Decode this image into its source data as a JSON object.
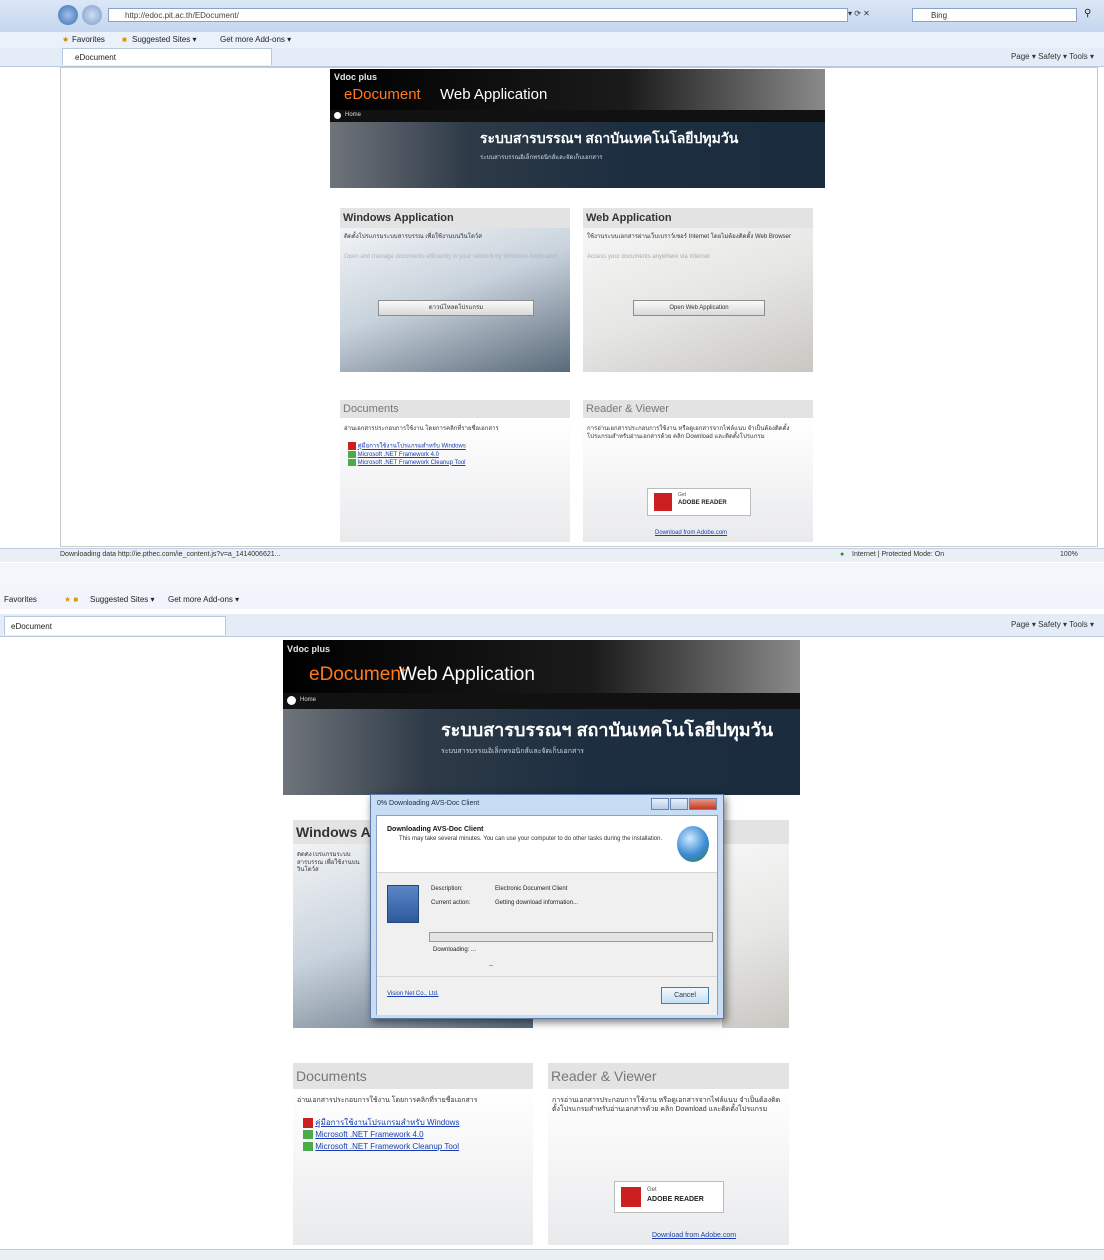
{
  "browser": {
    "url_top": "http://edoc.pit.ac.th/EDocument/",
    "search_engine": "Bing",
    "favorites_label": "Favorites",
    "suggested_sites": "Suggested Sites ▾",
    "get_addons": "Get more Add-ons ▾",
    "tab_title": "eDocument",
    "commands": "Page ▾  Safety ▾  Tools ▾",
    "status_text": "Downloading data http://ie.pthec.com/ie_content.js?v=a_1414006621...",
    "zone_text": "Internet | Protected Mode: On",
    "zoom": "100%"
  },
  "site": {
    "logo_small": "Vdoc plus",
    "logo_e": "eDocument",
    "logo_app": "Web Application",
    "home_label": "Home",
    "banner_title": "ระบบสารบรรณฯ สถาบันเทคโนโลยีปทุมวัน",
    "banner_sub": "ระบบสารบรรณอิเล็กทรอนิกส์และจัดเก็บเอกสาร",
    "windows_title": "Windows Application",
    "windows_title_partial": "Windows Ap",
    "windows_text": "ติดตั้งโปรแกรมระบบสารบรรณ เพื่อใช้งานบนวินโดว์ส",
    "windows_text2": "Open and manage documents efficiently in your network by Windows Application",
    "windows_button": "ดาวน์โหลดโปรแกรม",
    "web_title": "Web Application",
    "web_text": "ใช้งานระบบเอกสารผ่านเว็บเบราว์เซอร์ Internet โดยไม่ต้องติดตั้ง Web Browser",
    "web_text2": "Access your documents anywhere via Internet",
    "web_button": "Open Web Application",
    "documents_title": "Documents",
    "documents_text": "อ่านเอกสารประกอบการใช้งาน โดยการคลิกที่รายชื่อเอกสาร",
    "doc_links": [
      "คู่มือการใช้งานโปรแกรมสำหรับ Windows",
      "Microsoft .NET Framework 4.0",
      "Microsoft .NET Framework Cleanup Tool"
    ],
    "reader_title": "Reader & Viewer",
    "reader_text": "การอ่านเอกสารประกอบการใช้งาน หรือดูเอกสารจากไฟล์แนบ จำเป็นต้องติดตั้งโปรแกรมสำหรับอ่านเอกสารด้วย คลิก Download และติดตั้งโปรแกรม",
    "reader_badge_get": "Get",
    "reader_badge": "ADOBE READER",
    "reader_link": "Download from Adobe.com"
  },
  "dialog": {
    "title": "0% Downloading AVS-Doc Client",
    "heading": "Downloading AVS-Doc Client",
    "subtext": "This may take several minutes. You can use your computer to do other tasks during the installation.",
    "desc_label": "Description:",
    "desc_value": "Electronic Document Client",
    "action_label": "Current action:",
    "action_value": "Getting download information...",
    "downloading_label": "Downloading: ...",
    "dash": "--",
    "link": "Vision Net Co., Ltd.",
    "cancel": "Cancel",
    "progress": 0
  }
}
